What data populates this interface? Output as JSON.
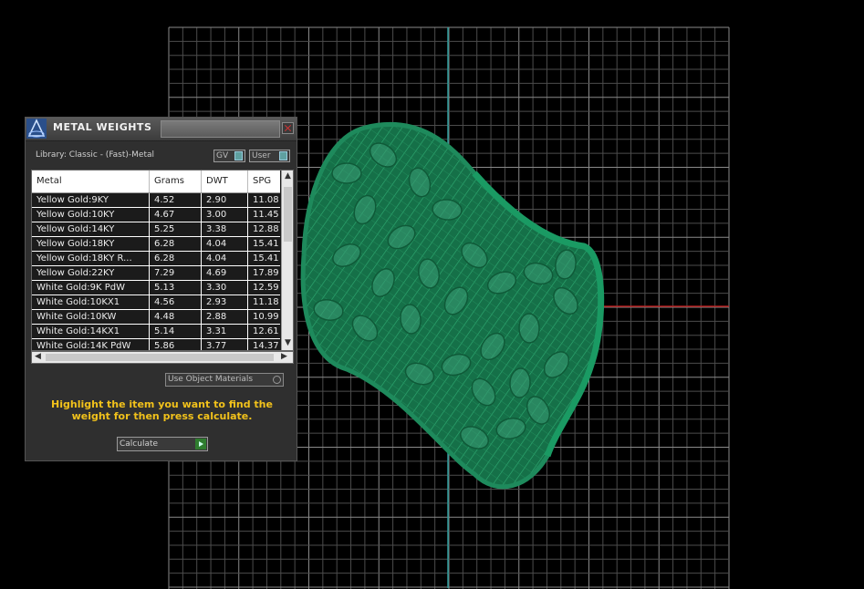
{
  "panel": {
    "title": "METAL WEIGHTS",
    "library": "Library: Classic - (Fast)-Metal",
    "gv_label": "GV",
    "user_label": "User",
    "columns": [
      "Metal",
      "Grams",
      "DWT",
      "SPG"
    ],
    "rows": [
      {
        "metal": "Yellow Gold:9KY",
        "grams": "4.52",
        "dwt": "2.90",
        "spg": "11.08"
      },
      {
        "metal": "Yellow Gold:10KY",
        "grams": "4.67",
        "dwt": "3.00",
        "spg": "11.45"
      },
      {
        "metal": "Yellow Gold:14KY",
        "grams": "5.25",
        "dwt": "3.38",
        "spg": "12.88"
      },
      {
        "metal": "Yellow Gold:18KY",
        "grams": "6.28",
        "dwt": "4.04",
        "spg": "15.41"
      },
      {
        "metal": "Yellow Gold:18KY R...",
        "grams": "6.28",
        "dwt": "4.04",
        "spg": "15.41"
      },
      {
        "metal": "Yellow Gold:22KY",
        "grams": "7.29",
        "dwt": "4.69",
        "spg": "17.89"
      },
      {
        "metal": "White Gold:9K PdW",
        "grams": "5.13",
        "dwt": "3.30",
        "spg": "12.59"
      },
      {
        "metal": "White Gold:10KX1",
        "grams": "4.56",
        "dwt": "2.93",
        "spg": "11.18"
      },
      {
        "metal": "White Gold:10KW",
        "grams": "4.48",
        "dwt": "2.88",
        "spg": "10.99"
      },
      {
        "metal": "White Gold:14KX1",
        "grams": "5.14",
        "dwt": "3.31",
        "spg": "12.61"
      },
      {
        "metal": "White Gold:14K PdW",
        "grams": "5.86",
        "dwt": "3.77",
        "spg": "14.37"
      }
    ],
    "use_object_materials": "Use Object Materials",
    "hint": "Highlight the item you want to find the weight for then press calculate.",
    "calculate_label": "Calculate"
  },
  "colors": {
    "background": "#000000",
    "grid": "#6a6a6a",
    "mesh": "#1e8a5c",
    "axis_x": "#b41e1e",
    "axis_y": "#2a9a9a",
    "hint": "#f2c21b"
  },
  "icons": {
    "logo": "pyramid-logo-icon",
    "close": "close-icon"
  }
}
